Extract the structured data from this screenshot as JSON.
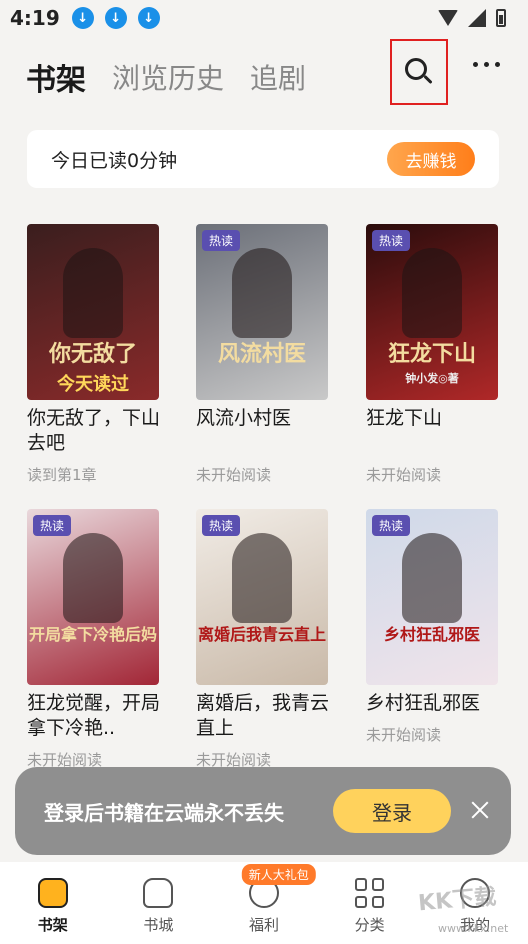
{
  "status_bar": {
    "time": "4:19",
    "download_icons": [
      "download-icon",
      "download-icon",
      "download-icon"
    ]
  },
  "header": {
    "tabs": [
      {
        "label": "书架",
        "active": true
      },
      {
        "label": "浏览历史",
        "active": false
      },
      {
        "label": "追剧",
        "active": false
      }
    ],
    "search_icon": "search-icon",
    "more_icon": "more-icon"
  },
  "banner": {
    "text": "今日已读0分钟",
    "button": "去赚钱"
  },
  "books": [
    {
      "title": "你无敌了，下山去吧",
      "status": "读到第1章",
      "hot": "",
      "cover_text": "你无敌了",
      "cover_sub": "今天读过",
      "colors": [
        "#3a1e1e",
        "#8a2a2a"
      ]
    },
    {
      "title": "风流小村医",
      "status": "未开始阅读",
      "hot": "热读",
      "cover_text": "风流村医",
      "cover_sub": "",
      "colors": [
        "#6b6f78",
        "#c9c9c9"
      ]
    },
    {
      "title": "狂龙下山",
      "status": "未开始阅读",
      "hot": "热读",
      "cover_text": "狂龙下山",
      "cover_sub": "钟小发◎著",
      "colors": [
        "#2a0c0c",
        "#b02828"
      ]
    },
    {
      "title": "狂龙觉醒，开局拿下冷艳..",
      "status": "未开始阅读",
      "hot": "热读",
      "cover_text": "开局拿下冷艳后妈",
      "cover_sub": "",
      "colors": [
        "#e9d8dc",
        "#a22636"
      ]
    },
    {
      "title": "离婚后，我青云直上",
      "status": "未开始阅读",
      "hot": "热读",
      "cover_text": "离婚后我青云直上",
      "cover_sub": "",
      "colors": [
        "#f1ece6",
        "#c9b9a8"
      ]
    },
    {
      "title": "乡村狂乱邪医",
      "status": "未开始阅读",
      "hot": "热读",
      "cover_text": "乡村狂乱邪医",
      "cover_sub": "",
      "colors": [
        "#cfd9e9",
        "#f0e4ea"
      ]
    }
  ],
  "login_toast": {
    "text": "登录后书籍在云端永不丢失",
    "button": "登录"
  },
  "bottom_nav": [
    {
      "label": "书架",
      "icon": "bookshelf-icon",
      "active": true,
      "badge": ""
    },
    {
      "label": "书城",
      "icon": "bookstore-icon",
      "active": false,
      "badge": ""
    },
    {
      "label": "福利",
      "icon": "welfare-icon",
      "active": false,
      "badge": "新人大礼包"
    },
    {
      "label": "分类",
      "icon": "category-icon",
      "active": false,
      "badge": ""
    },
    {
      "label": "我的",
      "icon": "profile-icon",
      "active": false,
      "badge": ""
    }
  ],
  "watermark": {
    "logo": "KK下载",
    "url": "www.kkx.net"
  }
}
